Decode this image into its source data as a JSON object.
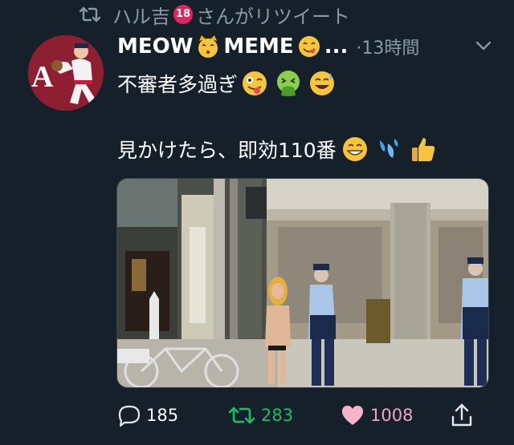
{
  "retweet_context": {
    "text_before": "ハル吉",
    "badge": "18",
    "text_after": "さんがリツイート"
  },
  "author": {
    "name_part1": "MEOW",
    "name_part2": "MEME",
    "ellipsis": "..."
  },
  "timestamp": "·13時間",
  "tweet": {
    "line1": "不審者多過ぎ",
    "line2": "見かけたら、即効110番"
  },
  "actions": {
    "reply_count": "185",
    "retweet_count": "283",
    "like_count": "1008"
  },
  "colors": {
    "background": "#15202b",
    "secondary_text": "#8b98a5",
    "retweet_green": "#17bf63",
    "like_pink": "#e0245e"
  },
  "icons": {
    "retweet": "retweet-icon",
    "reply": "reply-icon",
    "like": "heart-icon",
    "share": "share-icon",
    "more": "chevron-down-icon"
  }
}
